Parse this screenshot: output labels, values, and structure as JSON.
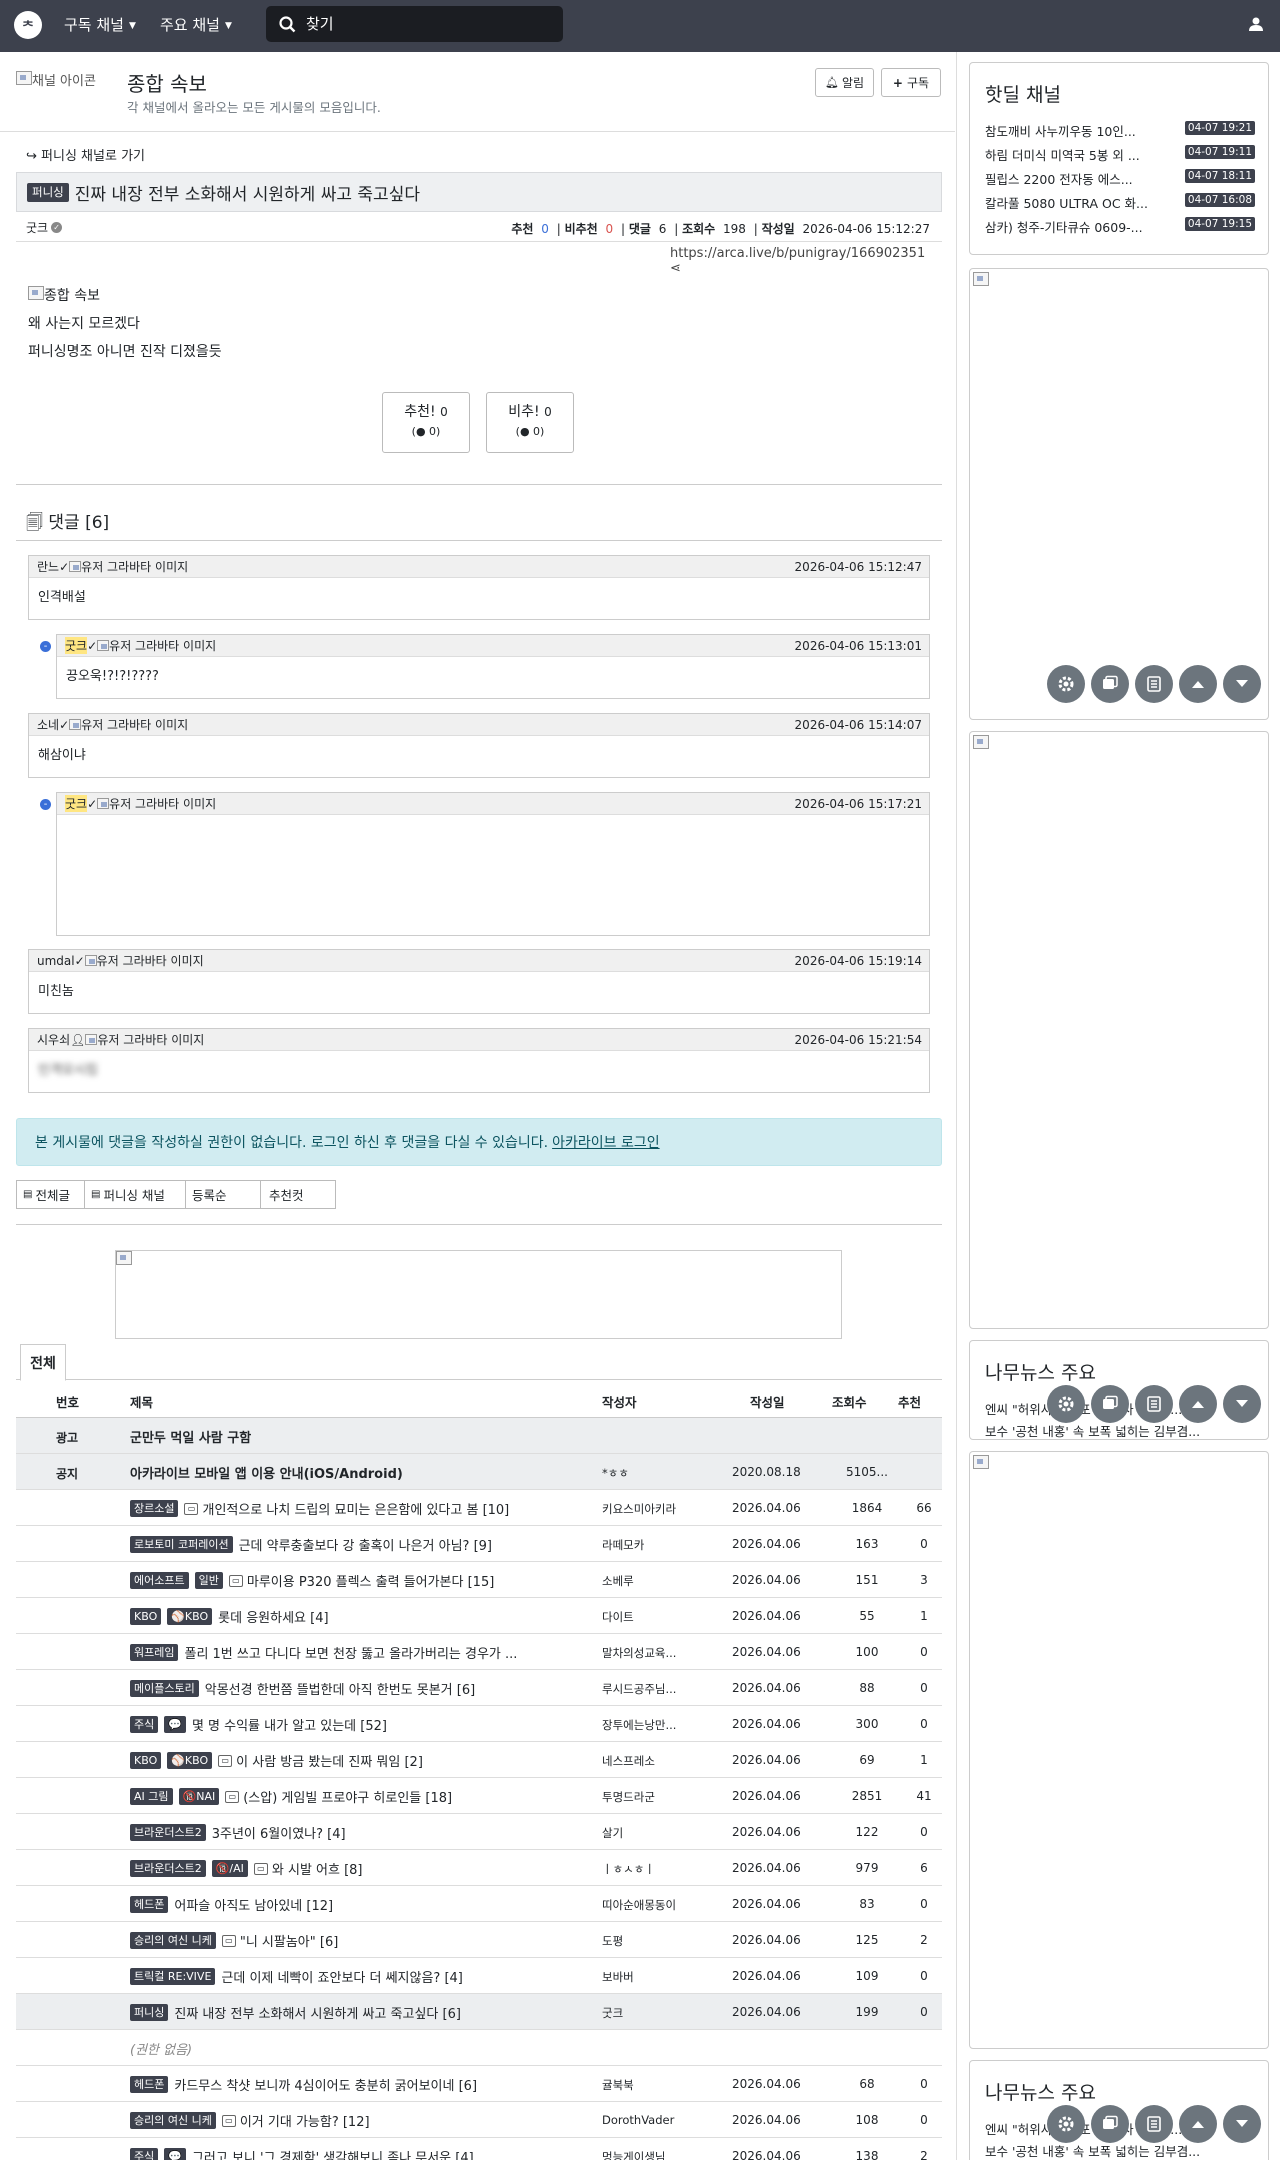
{
  "topnav": {
    "logo": "ᄎ",
    "subscribed_label": "구독 채널",
    "main_label": "주요 채널",
    "search_placeholder": "찾기"
  },
  "header": {
    "channel_icon_alt": "채널 아이콘",
    "title": "종합 속보",
    "desc": "각 채널에서 올라오는 모든 게시물의 모음입니다.",
    "alarm_label": "알림",
    "subscribe_label": "구독"
  },
  "post": {
    "back_link": "퍼니싱 채널로 가기",
    "category": "퍼니싱",
    "title": "진짜 내장 전부 소화해서 시원하게 싸고 죽고싶다",
    "author": "굿크",
    "rec_label": "추천",
    "rec": "0",
    "unrec_label": "비추천",
    "unrec": "0",
    "cmt_label": "댓글",
    "cmt": "6",
    "views_label": "조회수",
    "views": "198",
    "date_label": "작성일",
    "date": "2026-04-06 15:12:27",
    "url": "https://arca.live/b/punigray/166902351",
    "img_alt": "종합 속보",
    "body_lines": [
      "왜 사는지 모르겠다",
      "퍼니싱명조 아니면 진작 디졌을듯"
    ],
    "vote_up_label": "추천!",
    "vote_up": "0",
    "vote_up_sub": "0",
    "vote_down_label": "비추!",
    "vote_down": "0",
    "vote_down_sub": "0"
  },
  "comments_header": "댓글 [6]",
  "comments": [
    {
      "author": "란느",
      "avatar_alt": "유저 그라바타 이미지",
      "date": "2026-04-06 15:12:47",
      "text": "인격배설"
    },
    {
      "author": "굿크",
      "avatar_alt": "유저 그라바타 이미지",
      "date": "2026-04-06 15:13:01",
      "text": "끙오욱!?!?!????"
    },
    {
      "author": "소네",
      "avatar_alt": "유저 그라바타 이미지",
      "date": "2026-04-06 15:14:07",
      "text": "해삼이냐"
    },
    {
      "author": "굿크",
      "avatar_alt": "유저 그라바타 이미지",
      "date": "2026-04-06 15:17:21",
      "text": ""
    },
    {
      "author": "umdal",
      "avatar_alt": "유저 그라바타 이미지",
      "date": "2026-04-06 15:19:14",
      "text": "미친놈"
    },
    {
      "author": "시우쇠",
      "avatar_alt": "유저 그라바타 이미지",
      "date": "2026-04-06 15:21:54",
      "text": "인격모시킴"
    }
  ],
  "notice": {
    "text": "본 게시물에 댓글을 작성하실 권한이 없습니다. 로그인 하신 후 댓글을 다실 수 있습니다.",
    "link": "아카라이브 로그인"
  },
  "list_tabs": [
    "전체글",
    "퍼니싱 채널",
    "등록순",
    "추천컷"
  ],
  "board_tab": "전체",
  "table_headers": [
    "번호",
    "제목",
    "작성자",
    "작성일",
    "조회수",
    "추천"
  ],
  "rows": [
    {
      "num": "광고",
      "badges": [],
      "title": "군만두 먹일 사람 구함",
      "author": "",
      "date": "",
      "views": "",
      "rec": "",
      "bold": true,
      "gray": true
    },
    {
      "num": "공지",
      "badges": [],
      "title": "아카라이브 모바일 앱 이용 안내(iOS/Android)",
      "author": "*ㅎㅎ",
      "date": "2020.08.18",
      "views": "5105...",
      "rec": "",
      "bold": true,
      "gray": true
    },
    {
      "num": "",
      "badges": [
        "장르소설"
      ],
      "img": true,
      "title": "개인적으로 나치 드립의 묘미는 은은함에 있다고 봄 [10]",
      "author": "키요스미아키라",
      "date": "2026.04.06",
      "views": "1864",
      "rec": "66"
    },
    {
      "num": "",
      "badges": [
        "로보토미 코퍼레이션"
      ],
      "title": "근데 약루충출보다 강 출혹이 나은거 아님? [9]",
      "author": "라떼모카",
      "date": "2026.04.06",
      "views": "163",
      "rec": "0"
    },
    {
      "num": "",
      "badges": [
        "에어소프트",
        "일반"
      ],
      "img": true,
      "title": "마루이용 P320 플렉스 출력 들어가본다 [15]",
      "author": "소베루",
      "date": "2026.04.06",
      "views": "151",
      "rec": "3"
    },
    {
      "num": "",
      "badges": [
        "KBO",
        "⚾KBO"
      ],
      "title": "롯데 응원하세요 [4]",
      "author": "다이트",
      "date": "2026.04.06",
      "views": "55",
      "rec": "1"
    },
    {
      "num": "",
      "badges": [
        "워프레임"
      ],
      "title": "폴리 1번 쓰고 다니다 보면 천장 뚫고 올라가버리는 경우가 ...",
      "author": "말차의성교육...",
      "date": "2026.04.06",
      "views": "100",
      "rec": "0"
    },
    {
      "num": "",
      "badges": [
        "메이플스토리"
      ],
      "title": "악몽선경 한번쯤 뜰법한데 아직 한번도 못본거 [6]",
      "author": "루시드공주님...",
      "date": "2026.04.06",
      "views": "88",
      "rec": "0"
    },
    {
      "num": "",
      "badges": [
        "주식",
        "💬"
      ],
      "title": "몇 명 수익률 내가 알고 있는데 [52]",
      "author": "장투에는낭만...",
      "date": "2026.04.06",
      "views": "300",
      "rec": "0"
    },
    {
      "num": "",
      "badges": [
        "KBO",
        "⚾KBO"
      ],
      "img": true,
      "title": "이 사람 방금 봤는데 진짜 뭐임 [2]",
      "author": "네스프레소",
      "date": "2026.04.06",
      "views": "69",
      "rec": "1"
    },
    {
      "num": "",
      "badges": [
        "AI 그림",
        "🔞NAI"
      ],
      "img": true,
      "title": "(스압) 게임빌 프로야구 히로인들 [18]",
      "author": "투명드라군",
      "date": "2026.04.06",
      "views": "2851",
      "rec": "41"
    },
    {
      "num": "",
      "badges": [
        "브라운더스트2"
      ],
      "title": "3주년이 6월이였나? [4]",
      "author": "살기",
      "date": "2026.04.06",
      "views": "122",
      "rec": "0"
    },
    {
      "num": "",
      "badges": [
        "브라운더스트2",
        "🔞/AI"
      ],
      "img": true,
      "title": "와 시발 어흐 [8]",
      "author": "ㅣㅎㅅㅎㅣ",
      "date": "2026.04.06",
      "views": "979",
      "rec": "6"
    },
    {
      "num": "",
      "badges": [
        "헤드폰"
      ],
      "title": "어파슬 아직도 남아있네 [12]",
      "author": "띠아순애몽동이",
      "date": "2026.04.06",
      "views": "83",
      "rec": "0"
    },
    {
      "num": "",
      "badges": [
        "승리의 여신 니케"
      ],
      "img": true,
      "title": "\"니 시팔놈아\" [6]",
      "author": "도평",
      "date": "2026.04.06",
      "views": "125",
      "rec": "2"
    },
    {
      "num": "",
      "badges": [
        "트릭컬 RE:VIVE"
      ],
      "title": "근데 이제 네빡이 죠안보다 더 쎄지않음? [4]",
      "author": "보바버",
      "date": "2026.04.06",
      "views": "109",
      "rec": "0"
    },
    {
      "num": "",
      "badges": [
        "퍼니싱"
      ],
      "title": "진짜 내장 전부 소화해서 시원하게 싸고 죽고싶다 [6]",
      "author": "굿크",
      "date": "2026.04.06",
      "views": "199",
      "rec": "0",
      "gray": true
    },
    {
      "num": "",
      "badges": [],
      "title": "(권한 없음)",
      "author": "",
      "date": "",
      "views": "",
      "rec": "",
      "italic": true
    },
    {
      "num": "",
      "badges": [
        "헤드폰"
      ],
      "title": "카드무스 착샷 보니까 4심이어도 충분히 굵어보이네 [6]",
      "author": "귤북북",
      "date": "2026.04.06",
      "views": "68",
      "rec": "0"
    },
    {
      "num": "",
      "badges": [
        "승리의 여신 니케"
      ],
      "img": true,
      "title": "이거 기대 가능함? [12]",
      "author": "DorothVader",
      "date": "2026.04.06",
      "views": "108",
      "rec": "0"
    },
    {
      "num": "",
      "badges": [
        "주식",
        "💬"
      ],
      "title": "그러고 보니 '그 경제학' 생각해보니 좀나 무서운 [4]",
      "author": "멍능게이생님",
      "date": "2026.04.06",
      "views": "138",
      "rec": "2"
    }
  ],
  "sidebar": {
    "hotdeal_title": "핫딜 채널",
    "hotdeals": [
      {
        "title": "참도깨비 사누끼우동 10인...",
        "time": "04-07 19:21"
      },
      {
        "title": "하림 더미식 미역국 5봉 외 ...",
        "time": "04-07 19:11"
      },
      {
        "title": "필립스 2200 전자동 에스...",
        "time": "04-07 18:11"
      },
      {
        "title": "칼라풀 5080 ULTRA OC 화...",
        "time": "04-07 16:08"
      },
      {
        "title": "삼카) 청주-기타큐슈 0609-...",
        "time": "04-07 19:15"
      }
    ],
    "news_title": "나무뉴스 주요",
    "news": [
      "엔씨 \"허위사실 유포 ... 수사 착수\" ...",
      "보수 '공천 내홍' 속 보폭 넓히는 김부겸..."
    ],
    "news_title2": "나무뉴스 주요",
    "news2": [
      "엔씨 \"허위사실 유포 ... 수사 착수\" ...",
      "보수 '공천 내홍' 속 보폭 넓히는 김부겸..."
    ]
  }
}
